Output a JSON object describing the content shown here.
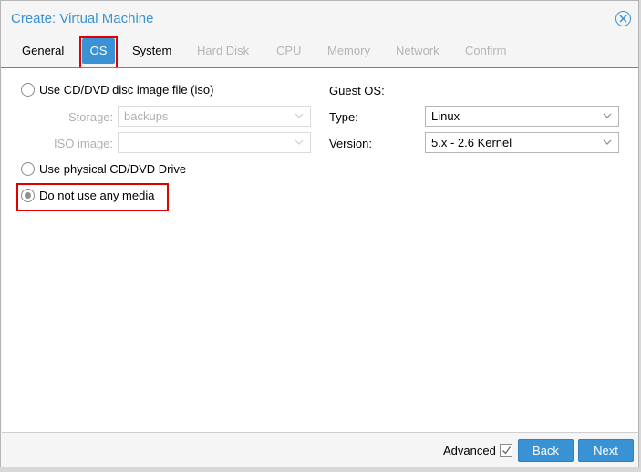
{
  "window": {
    "title": "Create: Virtual Machine"
  },
  "tabs": [
    {
      "label": "General",
      "state": "normal"
    },
    {
      "label": "OS",
      "state": "active"
    },
    {
      "label": "System",
      "state": "normal"
    },
    {
      "label": "Hard Disk",
      "state": "disabled"
    },
    {
      "label": "CPU",
      "state": "disabled"
    },
    {
      "label": "Memory",
      "state": "disabled"
    },
    {
      "label": "Network",
      "state": "disabled"
    },
    {
      "label": "Confirm",
      "state": "disabled"
    }
  ],
  "media": {
    "iso_option": "Use CD/DVD disc image file (iso)",
    "storage_label": "Storage:",
    "storage_value": "backups",
    "iso_image_label": "ISO image:",
    "iso_image_value": "",
    "physical_option": "Use physical CD/DVD Drive",
    "none_option": "Do not use any media",
    "selected": "none"
  },
  "guest_os": {
    "heading": "Guest OS:",
    "type_label": "Type:",
    "type_value": "Linux",
    "version_label": "Version:",
    "version_value": "5.x - 2.6 Kernel"
  },
  "footer": {
    "advanced_label": "Advanced",
    "advanced_checked": true,
    "back_label": "Back",
    "next_label": "Next"
  },
  "colors": {
    "accent": "#3892d4",
    "highlight": "#e00000",
    "disabled_text": "#b5b5b5"
  },
  "icons": [
    "close-icon",
    "chevron-down-icon",
    "checkmark-icon"
  ]
}
